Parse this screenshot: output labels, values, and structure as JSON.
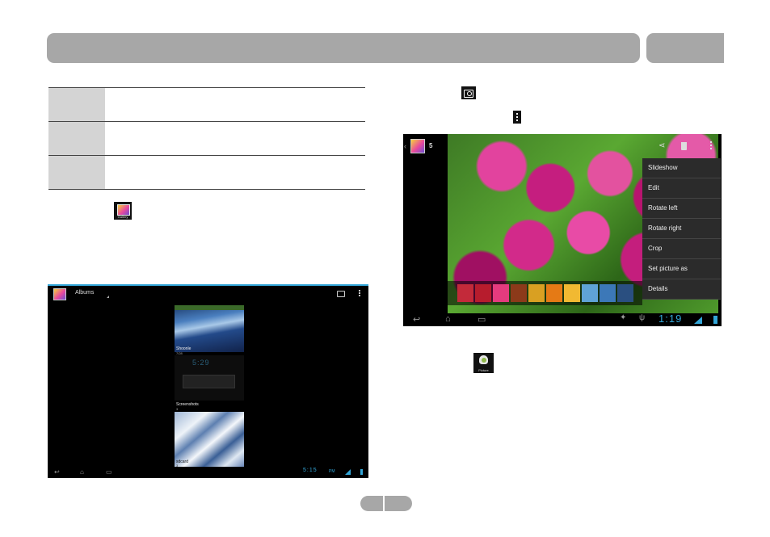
{
  "header": {
    "bar": "",
    "tab": ""
  },
  "inline_icons": {
    "gallery_icon": "gallery-app-icon",
    "gallery_icon_label": "Gallery",
    "camera_icon": "camera-icon",
    "menu_icon": "overflow-menu-icon",
    "picture_icon": "picture-app-icon",
    "picture_icon_label": "Picture"
  },
  "albums_screen": {
    "title": "Albums",
    "albums": [
      {
        "name": "Shoonle",
        "count": "7/28"
      },
      {
        "name": "Screenshots",
        "count": "3"
      },
      {
        "name": "sdcard",
        "count": "3"
      }
    ],
    "clock": "5:29",
    "status_time": "5:15",
    "status_ampm": "PM",
    "nav_back": "↩",
    "nav_home": "⌂",
    "nav_recent": "▭",
    "accent": "#33a6d8"
  },
  "photo_screen": {
    "count": "5",
    "menu": [
      "Slideshow",
      "Edit",
      "Rotate left",
      "Rotate right",
      "Crop",
      "Set picture as",
      "Details"
    ],
    "status_time": "1:19",
    "nav_back": "↩",
    "nav_home": "⌂",
    "nav_recent": "▭",
    "accent": "#33a6d8"
  },
  "colors": {
    "header_gray": "#a7a7a7",
    "table_label_gray": "#d4d4d4"
  }
}
